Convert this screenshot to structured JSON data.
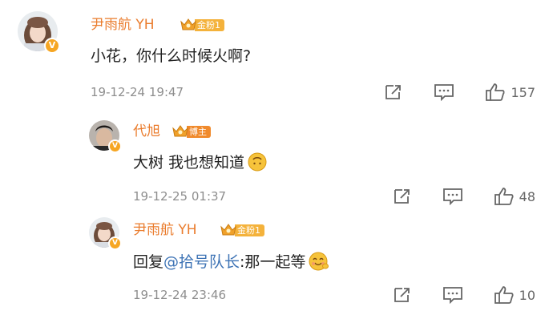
{
  "comments": [
    {
      "user": "尹雨航 YH",
      "badge": "金粉1",
      "text": "小花，你什么时候火啊?",
      "time": "19-12-24 19:47",
      "likes": "157"
    },
    {
      "user": "代旭",
      "badge": "博主",
      "text": "大树 我也想知道",
      "time": "19-12-25 01:37",
      "likes": "48"
    },
    {
      "user": "尹雨航 YH",
      "badge": "金粉1",
      "text_prefix": "回复",
      "mention": "@拾号队长",
      "text": ":那一起等",
      "time": "19-12-24 23:46",
      "likes": "10"
    }
  ],
  "icons": {
    "verified": "verified-badge-icon",
    "crown": "crown-icon",
    "share": "share-icon",
    "comment": "comment-icon",
    "like": "thumbs-up-icon",
    "emoji_smile": "upside-down-smile-emoji",
    "emoji_blush": "blush-smile-emoji"
  },
  "colors": {
    "username": "#ea7c2d",
    "mention": "#3d73b5",
    "badge_gold": "#f4b23b",
    "badge_blogger": "#f08a2c",
    "verified": "#f6a623"
  }
}
